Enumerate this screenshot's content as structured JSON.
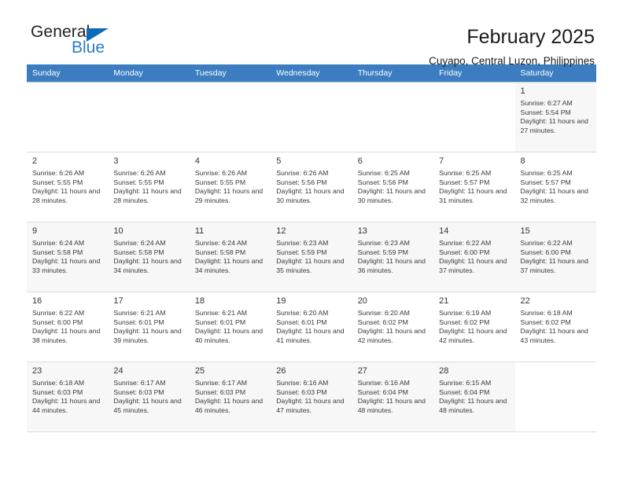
{
  "brand": {
    "name_dark": "General",
    "name_blue": "Blue",
    "accent_color": "#2b7cc4",
    "triangle_color": "#0d6cb9"
  },
  "header": {
    "title": "February 2025",
    "subtitle": "Cuyapo, Central Luzon, Philippines"
  },
  "calendar": {
    "header_bg": "#3b7dc0",
    "weekdays": [
      "Sunday",
      "Monday",
      "Tuesday",
      "Wednesday",
      "Thursday",
      "Friday",
      "Saturday"
    ],
    "weeks": [
      [
        {
          "day": "",
          "info": ""
        },
        {
          "day": "",
          "info": ""
        },
        {
          "day": "",
          "info": ""
        },
        {
          "day": "",
          "info": ""
        },
        {
          "day": "",
          "info": ""
        },
        {
          "day": "",
          "info": ""
        },
        {
          "day": "1",
          "info": "Sunrise: 6:27 AM\nSunset: 5:54 PM\nDaylight: 11 hours and 27 minutes."
        }
      ],
      [
        {
          "day": "2",
          "info": "Sunrise: 6:26 AM\nSunset: 5:55 PM\nDaylight: 11 hours and 28 minutes."
        },
        {
          "day": "3",
          "info": "Sunrise: 6:26 AM\nSunset: 5:55 PM\nDaylight: 11 hours and 28 minutes."
        },
        {
          "day": "4",
          "info": "Sunrise: 6:26 AM\nSunset: 5:55 PM\nDaylight: 11 hours and 29 minutes."
        },
        {
          "day": "5",
          "info": "Sunrise: 6:26 AM\nSunset: 5:56 PM\nDaylight: 11 hours and 30 minutes."
        },
        {
          "day": "6",
          "info": "Sunrise: 6:25 AM\nSunset: 5:56 PM\nDaylight: 11 hours and 30 minutes."
        },
        {
          "day": "7",
          "info": "Sunrise: 6:25 AM\nSunset: 5:57 PM\nDaylight: 11 hours and 31 minutes."
        },
        {
          "day": "8",
          "info": "Sunrise: 6:25 AM\nSunset: 5:57 PM\nDaylight: 11 hours and 32 minutes."
        }
      ],
      [
        {
          "day": "9",
          "info": "Sunrise: 6:24 AM\nSunset: 5:58 PM\nDaylight: 11 hours and 33 minutes."
        },
        {
          "day": "10",
          "info": "Sunrise: 6:24 AM\nSunset: 5:58 PM\nDaylight: 11 hours and 34 minutes."
        },
        {
          "day": "11",
          "info": "Sunrise: 6:24 AM\nSunset: 5:58 PM\nDaylight: 11 hours and 34 minutes."
        },
        {
          "day": "12",
          "info": "Sunrise: 6:23 AM\nSunset: 5:59 PM\nDaylight: 11 hours and 35 minutes."
        },
        {
          "day": "13",
          "info": "Sunrise: 6:23 AM\nSunset: 5:59 PM\nDaylight: 11 hours and 36 minutes."
        },
        {
          "day": "14",
          "info": "Sunrise: 6:22 AM\nSunset: 6:00 PM\nDaylight: 11 hours and 37 minutes."
        },
        {
          "day": "15",
          "info": "Sunrise: 6:22 AM\nSunset: 6:00 PM\nDaylight: 11 hours and 37 minutes."
        }
      ],
      [
        {
          "day": "16",
          "info": "Sunrise: 6:22 AM\nSunset: 6:00 PM\nDaylight: 11 hours and 38 minutes."
        },
        {
          "day": "17",
          "info": "Sunrise: 6:21 AM\nSunset: 6:01 PM\nDaylight: 11 hours and 39 minutes."
        },
        {
          "day": "18",
          "info": "Sunrise: 6:21 AM\nSunset: 6:01 PM\nDaylight: 11 hours and 40 minutes."
        },
        {
          "day": "19",
          "info": "Sunrise: 6:20 AM\nSunset: 6:01 PM\nDaylight: 11 hours and 41 minutes."
        },
        {
          "day": "20",
          "info": "Sunrise: 6:20 AM\nSunset: 6:02 PM\nDaylight: 11 hours and 42 minutes."
        },
        {
          "day": "21",
          "info": "Sunrise: 6:19 AM\nSunset: 6:02 PM\nDaylight: 11 hours and 42 minutes."
        },
        {
          "day": "22",
          "info": "Sunrise: 6:18 AM\nSunset: 6:02 PM\nDaylight: 11 hours and 43 minutes."
        }
      ],
      [
        {
          "day": "23",
          "info": "Sunrise: 6:18 AM\nSunset: 6:03 PM\nDaylight: 11 hours and 44 minutes."
        },
        {
          "day": "24",
          "info": "Sunrise: 6:17 AM\nSunset: 6:03 PM\nDaylight: 11 hours and 45 minutes."
        },
        {
          "day": "25",
          "info": "Sunrise: 6:17 AM\nSunset: 6:03 PM\nDaylight: 11 hours and 46 minutes."
        },
        {
          "day": "26",
          "info": "Sunrise: 6:16 AM\nSunset: 6:03 PM\nDaylight: 11 hours and 47 minutes."
        },
        {
          "day": "27",
          "info": "Sunrise: 6:16 AM\nSunset: 6:04 PM\nDaylight: 11 hours and 48 minutes."
        },
        {
          "day": "28",
          "info": "Sunrise: 6:15 AM\nSunset: 6:04 PM\nDaylight: 11 hours and 48 minutes."
        },
        {
          "day": "",
          "info": ""
        }
      ]
    ]
  }
}
